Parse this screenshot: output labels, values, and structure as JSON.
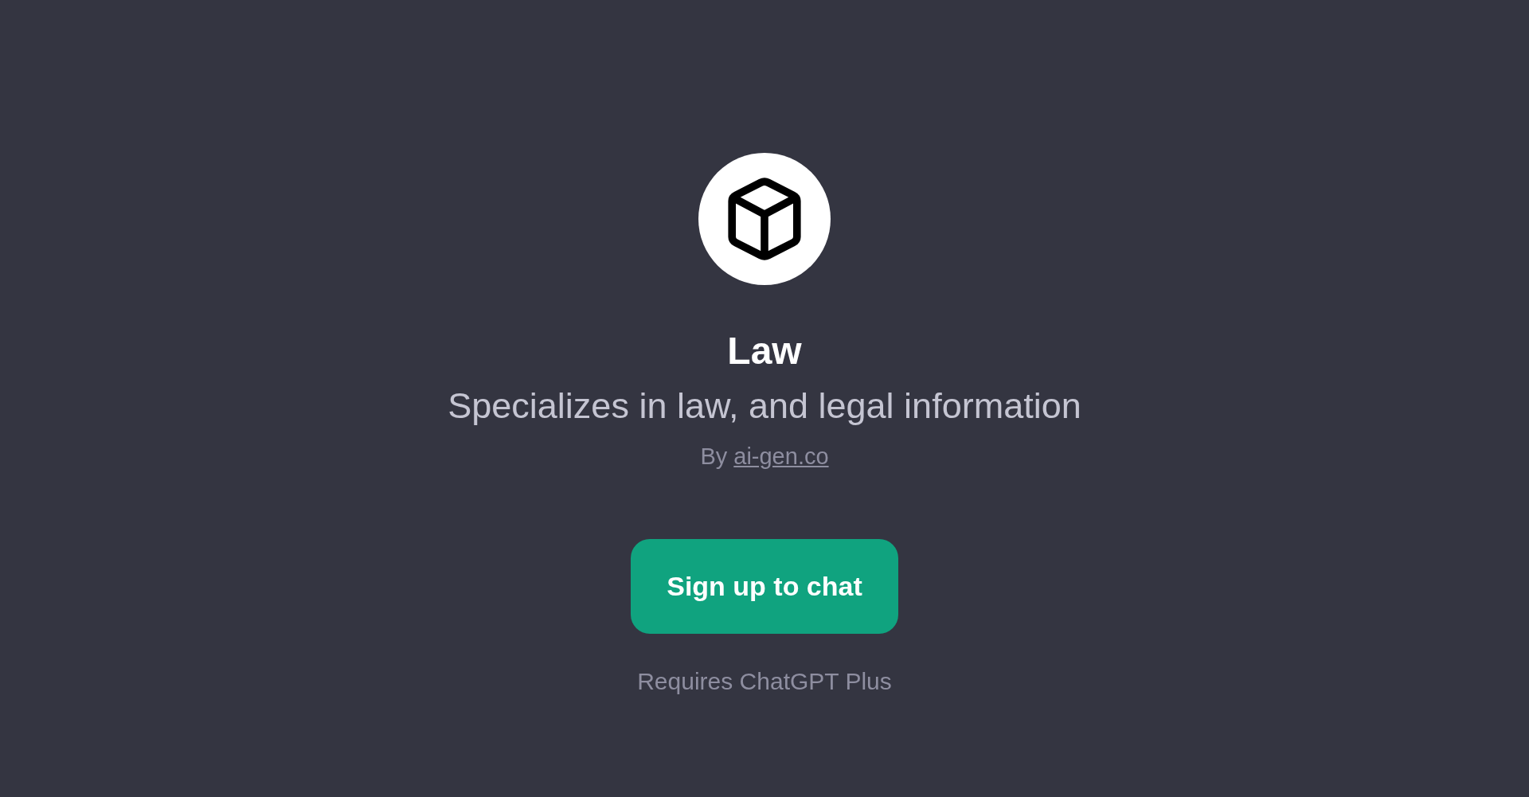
{
  "gpt": {
    "title": "Law",
    "description": "Specializes in law, and legal information",
    "author": {
      "prefix": "By",
      "link": "ai-gen.co"
    }
  },
  "signup_button": {
    "label": "Sign up to chat"
  },
  "requirement_note": "Requires ChatGPT Plus"
}
